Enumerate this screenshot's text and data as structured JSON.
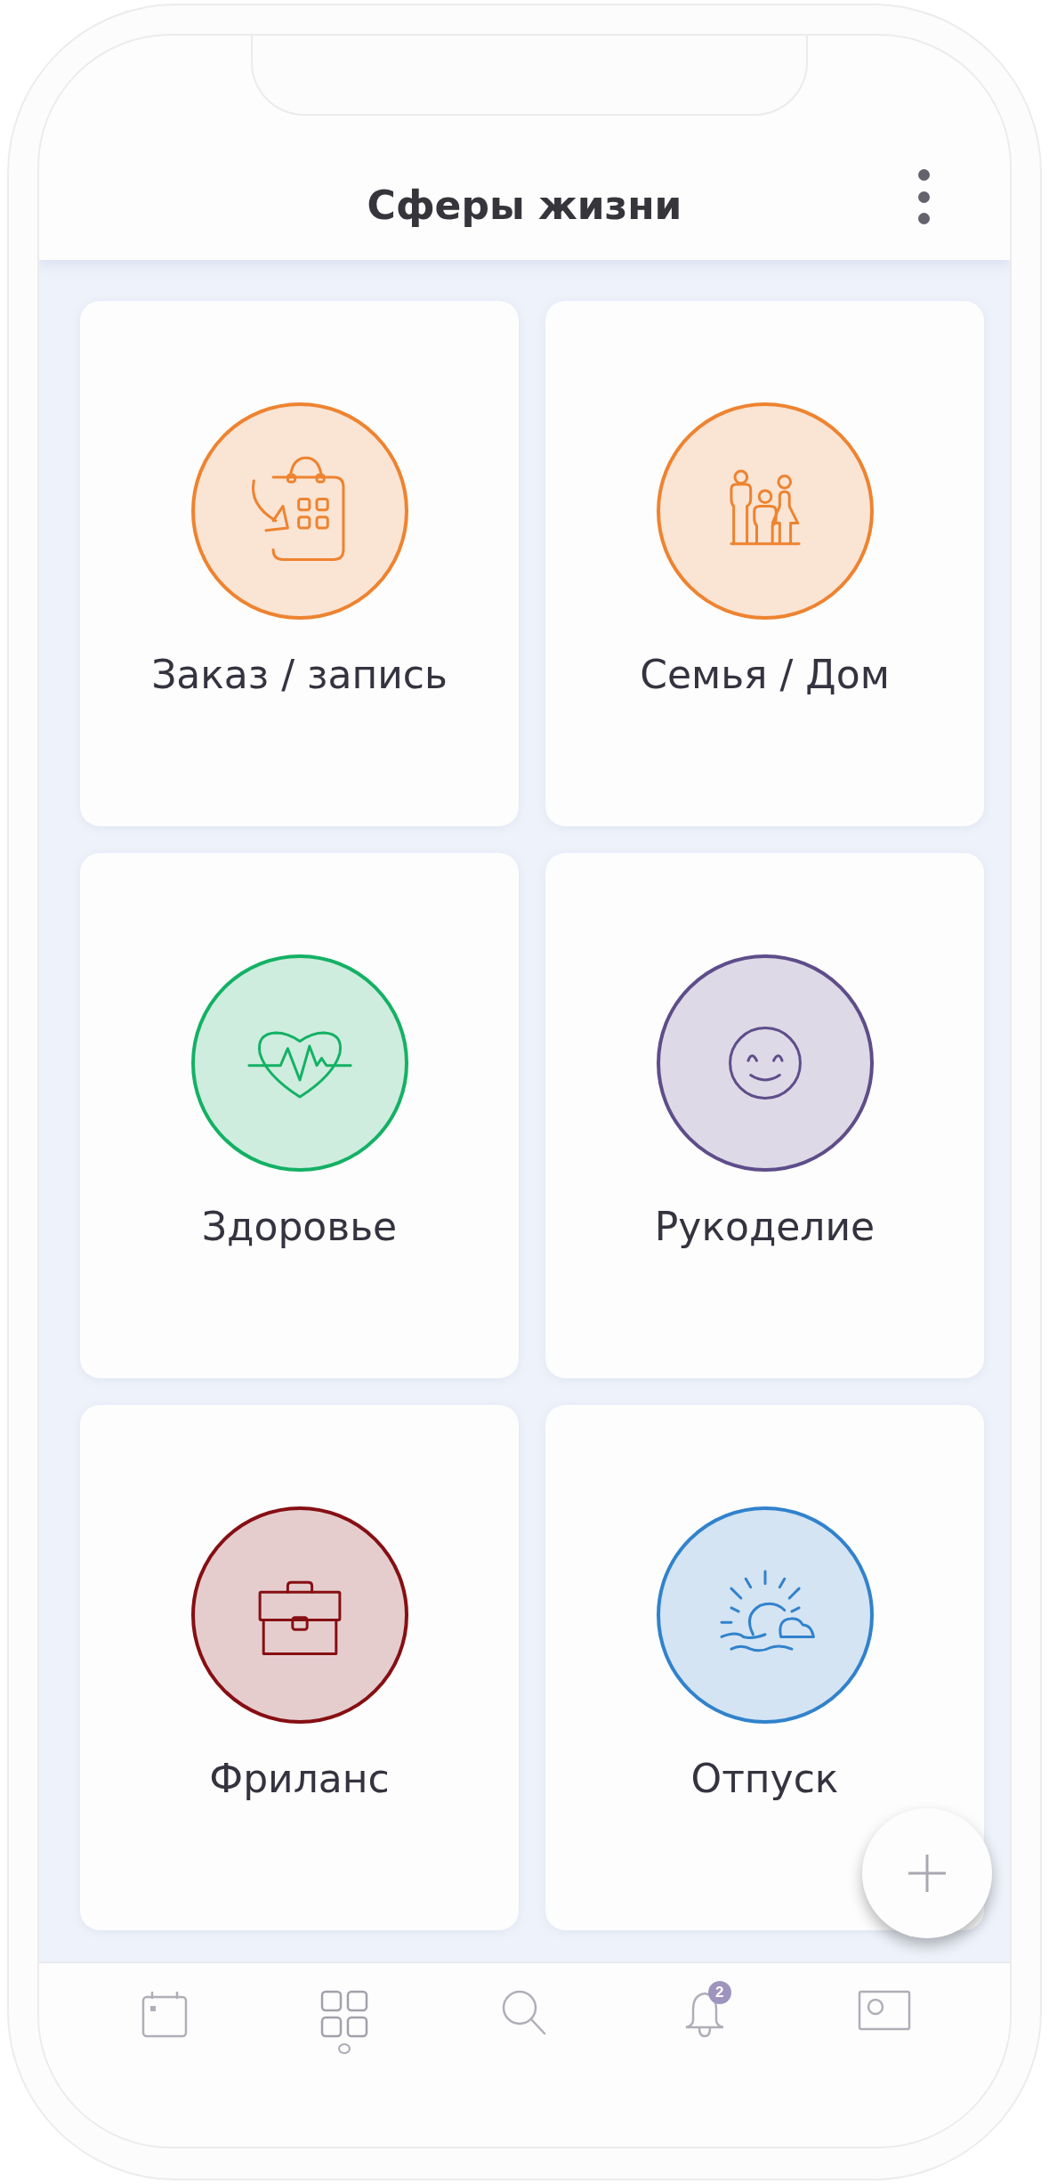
{
  "header": {
    "title": "Сферы жизни"
  },
  "tiles": [
    {
      "label": "Заказ / запись",
      "kind": "order",
      "color": "#ee8330"
    },
    {
      "label": "Семья / Дом",
      "kind": "family",
      "color": "#ee8330"
    },
    {
      "label": "Здоровье",
      "kind": "health",
      "color": "#14b164"
    },
    {
      "label": "Рукоделие",
      "kind": "craft",
      "color": "#5e4d8a"
    },
    {
      "label": "Фриланс",
      "kind": "work",
      "color": "#860f13"
    },
    {
      "label": "Отпуск",
      "kind": "vacation",
      "color": "#3182cc"
    }
  ],
  "nav": [
    {
      "kind": "calendar",
      "selected": false
    },
    {
      "kind": "spheres",
      "selected": true
    },
    {
      "kind": "search",
      "selected": false
    },
    {
      "kind": "notifications",
      "selected": false,
      "badge": "2"
    },
    {
      "kind": "profile",
      "selected": false
    }
  ]
}
